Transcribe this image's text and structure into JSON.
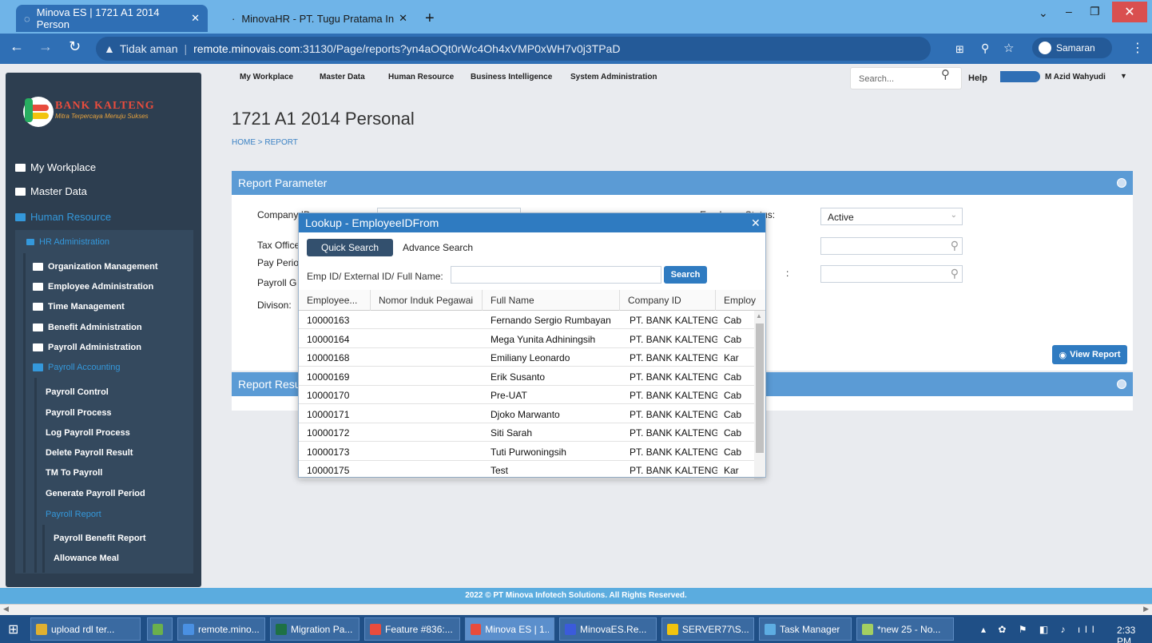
{
  "browser": {
    "tabs": [
      {
        "label": "Minova ES | 1721 A1 2014 Person",
        "active": true
      },
      {
        "label": "MinovaHR - PT. Tugu Pratama In",
        "active": false
      }
    ],
    "security_label": "Tidak aman",
    "url_host": "remote.minovais.com",
    "url_path": ":31130/Page/reports?yn4aOQt0rWc4Oh4xVMP0xWH7v0j3TPaD",
    "profile_label": "Samaran"
  },
  "sidebar": {
    "logo_title": "BANK KALTENG",
    "logo_subtitle": "Mitra Terpercaya Menuju Sukses",
    "items": [
      {
        "label": "My Workplace"
      },
      {
        "label": "Master Data"
      },
      {
        "label": "Human Resource"
      }
    ],
    "hr_admin": "HR Administration",
    "hr_items": [
      "Organization Management",
      "Employee Administration",
      "Time Management",
      "Benefit Administration",
      "Payroll Administration",
      "Payroll Accounting"
    ],
    "payroll_items": [
      "Payroll Control",
      "Payroll Process",
      "Log Payroll Process",
      "Delete Payroll Result",
      "TM To Payroll",
      "Generate Payroll Period",
      "Payroll Report"
    ],
    "report_items": [
      "Payroll Benefit Report",
      "Allowance Meal"
    ]
  },
  "topmenu": {
    "items": [
      "My Workplace",
      "Master Data",
      "Human Resource",
      "Business Intelligence",
      "System Administration"
    ],
    "search_placeholder": "Search...",
    "help": "Help",
    "user": "M Azid Wahyudi"
  },
  "page": {
    "title": "1721 A1 2014 Personal",
    "breadcrumb": "HOME > REPORT"
  },
  "report_param": {
    "header": "Report Parameter",
    "left_labels": [
      "Company ID",
      "Tax Office",
      "Pay Period",
      "Payroll G",
      "Divison:"
    ],
    "employee_status_label": "Employee Status:",
    "employee_status_value": "Active",
    "label_3": ":",
    "view_report": "View Report"
  },
  "report_result": {
    "header": "Report Result"
  },
  "lookup": {
    "title": "Lookup - EmployeeIDFrom",
    "tabs": [
      "Quick Search",
      "Advance Search"
    ],
    "search_label": "Emp ID/ External ID/ Full Name:",
    "search_button": "Search",
    "columns": [
      "Employee...",
      "Nomor Induk Pegawai",
      "Full Name",
      "Company ID",
      "Employ"
    ],
    "rows": [
      {
        "id": "10000163",
        "nip": "",
        "name": "Fernando Sergio Rumbayan",
        "company": "PT. BANK KALTENG",
        "emp": "Cab"
      },
      {
        "id": "10000164",
        "nip": "",
        "name": "Mega Yunita Adhiningsih",
        "company": "PT. BANK KALTENG",
        "emp": "Cab"
      },
      {
        "id": "10000168",
        "nip": "",
        "name": "Emiliany Leonardo",
        "company": "PT. BANK KALTENG",
        "emp": "Kar"
      },
      {
        "id": "10000169",
        "nip": "",
        "name": "Erik Susanto",
        "company": "PT. BANK KALTENG",
        "emp": "Cab"
      },
      {
        "id": "10000170",
        "nip": "",
        "name": "Pre-UAT",
        "company": "PT. BANK KALTENG",
        "emp": "Cab"
      },
      {
        "id": "10000171",
        "nip": "",
        "name": "Djoko Marwanto",
        "company": "PT. BANK KALTENG",
        "emp": "Cab"
      },
      {
        "id": "10000172",
        "nip": "",
        "name": "Siti Sarah",
        "company": "PT. BANK KALTENG",
        "emp": "Cab"
      },
      {
        "id": "10000173",
        "nip": "",
        "name": "Tuti Purwoningsih",
        "company": "PT. BANK KALTENG",
        "emp": "Cab"
      },
      {
        "id": "10000175",
        "nip": "",
        "name": "Test",
        "company": "PT. BANK KALTENG",
        "emp": "Kar"
      }
    ]
  },
  "footer": "2022 © PT Minova Infotech Solutions. All Rights Reserved.",
  "taskbar": {
    "items": [
      {
        "label": "upload rdl ter...",
        "color": "#e0b030"
      },
      {
        "label": "",
        "color": "#6ab04c"
      },
      {
        "label": "remote.mino...",
        "color": "#4a90e2"
      },
      {
        "label": "Migration Pa...",
        "color": "#1e7145"
      },
      {
        "label": "Feature #836:...",
        "color": "#e84c3d"
      },
      {
        "label": "Minova ES | 1...",
        "color": "#e84c3d"
      },
      {
        "label": "MinovaES.Re...",
        "color": "#3b5bdb"
      },
      {
        "label": "SERVER77\\S...",
        "color": "#f1c40f"
      },
      {
        "label": "Task Manager",
        "color": "#5dade2"
      },
      {
        "label": "*new 25 - No...",
        "color": "#a3cf62"
      }
    ],
    "clock": "2:33 PM"
  }
}
